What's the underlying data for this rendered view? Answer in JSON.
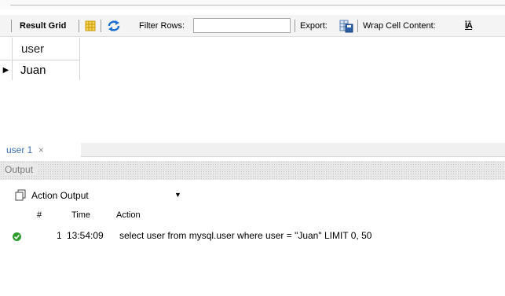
{
  "toolbar": {
    "result_grid_label": "Result Grid",
    "filter_rows_label": "Filter Rows:",
    "filter_rows_value": "",
    "export_label": "Export:",
    "wrap_cell_label": "Wrap Cell Content:",
    "wrap_icon_glyph": "ĪĀ"
  },
  "result_grid": {
    "columns": [
      "user"
    ],
    "rows": [
      [
        "Juan"
      ]
    ],
    "current_row_marker": "▶"
  },
  "result_tab": {
    "label": "user 1",
    "close_glyph": "×"
  },
  "output_panel": {
    "title": "Output",
    "selector_value": "Action Output",
    "columns": {
      "num": "#",
      "time": "Time",
      "action": "Action"
    },
    "rows": [
      {
        "num": "1",
        "time": "13:54:09",
        "action": "select user from mysql.user where user = \"Juan\" LIMIT 0, 50",
        "status": "success"
      }
    ]
  },
  "colors": {
    "success": "#2e9d2e",
    "refresh_icon": "#1b6fd1",
    "grid_icon": "#e0a800"
  }
}
